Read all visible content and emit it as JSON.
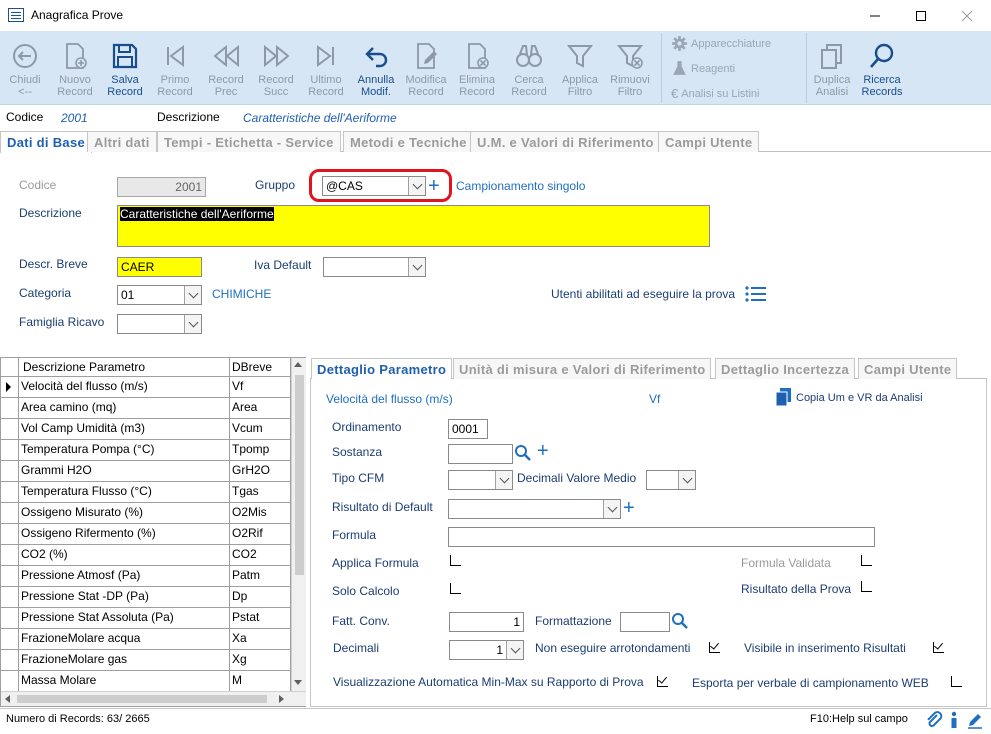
{
  "window": {
    "title": "Anagrafica Prove",
    "minimize": "—",
    "maximize": "☐",
    "close": "✕"
  },
  "toolbar": {
    "buttons": [
      {
        "label": "Chiudi\n<--",
        "icon": "back-circle-icon",
        "enabled": false
      },
      {
        "label": "Nuovo\nRecord",
        "icon": "new-document-icon",
        "enabled": false
      },
      {
        "label": "Salva\nRecord",
        "icon": "floppy-disk-icon",
        "enabled": true
      },
      {
        "label": "Primo\nRecord",
        "icon": "first-record-icon",
        "enabled": false
      },
      {
        "label": "Record\nPrec",
        "icon": "previous-record-icon",
        "enabled": false
      },
      {
        "label": "Record\nSucc",
        "icon": "next-record-icon",
        "enabled": false
      },
      {
        "label": "Ultimo\nRecord",
        "icon": "last-record-icon",
        "enabled": false
      },
      {
        "label": "Annulla\nModif.",
        "icon": "undo-arrow-icon",
        "enabled": true
      },
      {
        "label": "Modifica\nRecord",
        "icon": "edit-document-icon",
        "enabled": false
      },
      {
        "label": "Elimina\nRecord",
        "icon": "delete-document-icon",
        "enabled": false
      },
      {
        "label": "Cerca\nRecord",
        "icon": "binoculars-icon",
        "enabled": false
      },
      {
        "label": "Applica\nFiltro",
        "icon": "filter-icon",
        "enabled": false
      },
      {
        "label": "Rimuovi\nFiltro",
        "icon": "remove-filter-icon",
        "enabled": false
      }
    ],
    "side": [
      {
        "label": "Apparecchiature",
        "icon": "gear-icon"
      },
      {
        "label": "Reagenti",
        "icon": "flask-icon"
      },
      {
        "label": "Analisi su Listini",
        "icon": "euro-icon"
      }
    ],
    "right": [
      {
        "label": "Duplica\nAnalisi",
        "icon": "duplicate-icon",
        "enabled": false
      },
      {
        "label": "Ricerca\nRecords",
        "icon": "search-icon",
        "enabled": true
      }
    ]
  },
  "header": {
    "codice_label": "Codice",
    "codice_value": "2001",
    "descrizione_label": "Descrizione",
    "descrizione_value": "Caratteristiche dell'Aeriforme"
  },
  "main_tabs": [
    "Dati di Base",
    "Altri dati",
    "Tempi - Etichetta - Service",
    "Metodi e Tecniche",
    "U.M. e Valori di Riferimento",
    "Campi Utente"
  ],
  "form": {
    "codice_label": "Codice",
    "codice_value": "2001",
    "gruppo_label": "Gruppo",
    "gruppo_value": "@CAS",
    "gruppo_desc": "Campionamento singolo",
    "descrizione_label": "Descrizione",
    "descrizione_value": "Caratteristiche dell'Aeriforme",
    "descr_breve_label": "Descr. Breve",
    "descr_breve_value": "CAER",
    "iva_label": "Iva Default",
    "iva_value": "",
    "categoria_label": "Categoria",
    "categoria_value": "01",
    "categoria_desc": "CHIMICHE",
    "utenti_label": "Utenti abilitati ad eseguire la prova",
    "famiglia_label": "Famiglia Ricavo",
    "famiglia_value": ""
  },
  "grid": {
    "headers": [
      "Descrizione Parametro",
      "DBreve"
    ],
    "rows": [
      [
        "Velocità del flusso (m/s)",
        "Vf"
      ],
      [
        "Area camino (mq)",
        "Area"
      ],
      [
        "Vol Camp Umidità (m3)",
        "Vcum"
      ],
      [
        "Temperatura Pompa (°C)",
        "Tpomp"
      ],
      [
        "Grammi H2O",
        "GrH2O"
      ],
      [
        "Temperatura Flusso (°C)",
        "Tgas"
      ],
      [
        "Ossigeno Misurato (%)",
        "O2Mis"
      ],
      [
        "Ossigeno Rifermento (%)",
        "O2Rif"
      ],
      [
        "CO2 (%)",
        "CO2"
      ],
      [
        "Pressione Atmosf (Pa)",
        "Patm"
      ],
      [
        "Pressione Stat -DP (Pa)",
        "Dp"
      ],
      [
        "Pressione Stat Assoluta (Pa)",
        "Pstat"
      ],
      [
        "FrazioneMolare acqua",
        "Xa"
      ],
      [
        "FrazioneMolare gas",
        "Xg"
      ],
      [
        "Massa Molare",
        "M"
      ]
    ]
  },
  "detail_tabs": [
    "Dettaglio Parametro",
    "Unità di misura e Valori di Riferimento",
    "Dettaglio Incertezza",
    "Campi Utente"
  ],
  "detail": {
    "param_name": "Velocità del flusso (m/s)",
    "param_short": "Vf",
    "copy_label": "Copia Um e VR da Analisi",
    "ordinamento_label": "Ordinamento",
    "ordinamento_value": "0001",
    "sostanza_label": "Sostanza",
    "sostanza_value": "",
    "tipo_cfm_label": "Tipo CFM",
    "tipo_cfm_value": "",
    "decimali_medio_label": "Decimali Valore Medio",
    "decimali_medio_value": "",
    "risultato_label": "Risultato di Default",
    "risultato_value": "",
    "formula_label": "Formula",
    "formula_value": "",
    "applica_formula_label": "Applica Formula",
    "formula_validata_label": "Formula Validata",
    "solo_calcolo_label": "Solo Calcolo",
    "risultato_prova_label": "Risultato della Prova",
    "fatt_conv_label": "Fatt. Conv.",
    "fatt_conv_value": "1",
    "formattazione_label": "Formattazione",
    "formattazione_value": "",
    "decimali_label": "Decimali",
    "decimali_value": "1",
    "non_arrot_label": "Non eseguire arrotondamenti",
    "visibile_label": "Visibile in inserimento Risultati",
    "vis_auto_label": "Visualizzazione Automatica Min-Max su Rapporto di Prova",
    "esporta_label": "Esporta per verbale di campionamento WEB"
  },
  "status": {
    "records": "Numero di Records: 63/ 2665",
    "help": "F10:Help sul campo"
  }
}
